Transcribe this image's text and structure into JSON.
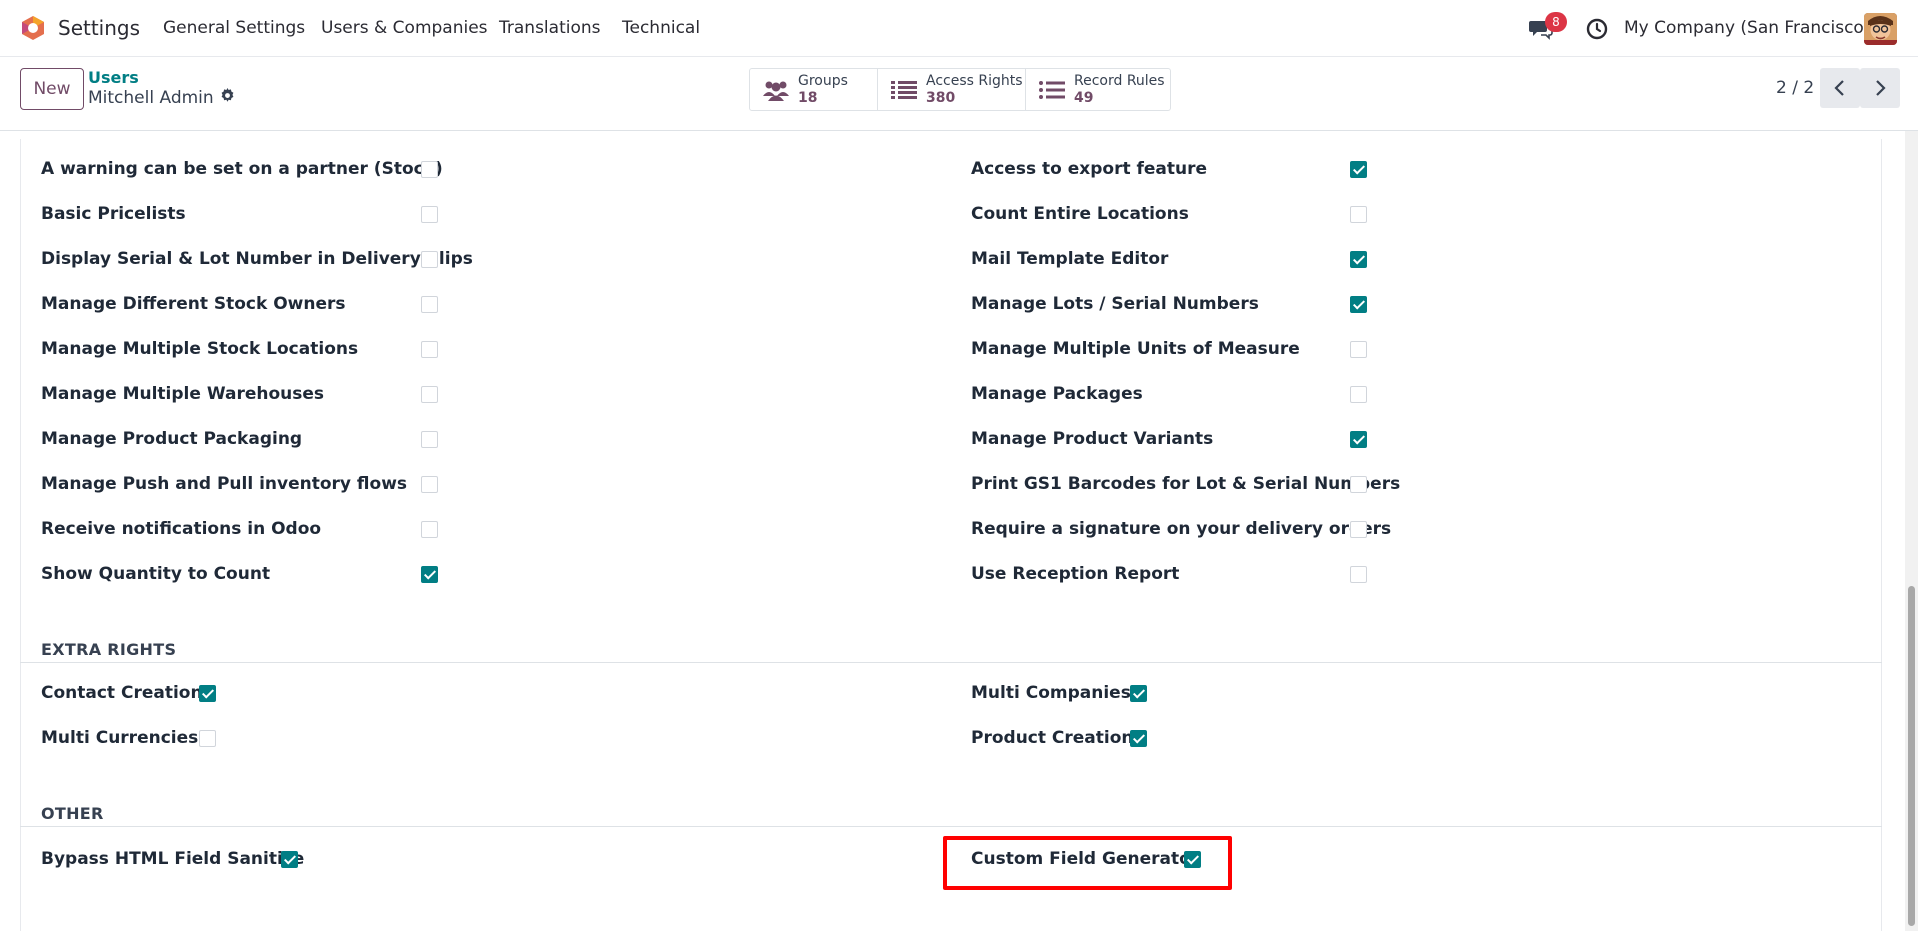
{
  "navbar": {
    "app_name": "Settings",
    "menu": [
      "General Settings",
      "Users & Companies",
      "Translations",
      "Technical"
    ],
    "messages_count": "8",
    "company": "My Company (San Francisco)"
  },
  "control_panel": {
    "new_label": "New",
    "breadcrumb_parent": "Users",
    "record_name": "Mitchell Admin",
    "smart_buttons": [
      {
        "label": "Groups",
        "value": "18",
        "icon": "users-icon"
      },
      {
        "label": "Access Rights",
        "value": "380",
        "icon": "list-icon"
      },
      {
        "label": "Record Rules",
        "value": "49",
        "icon": "list-icon"
      }
    ],
    "pager": "2 / 2"
  },
  "technical_rights": {
    "left": [
      {
        "label": "A warning can be set on a partner (Stock)",
        "checked": false
      },
      {
        "label": "Basic Pricelists",
        "checked": false
      },
      {
        "label": "Display Serial & Lot Number in Delivery Slips",
        "checked": false
      },
      {
        "label": "Manage Different Stock Owners",
        "checked": false
      },
      {
        "label": "Manage Multiple Stock Locations",
        "checked": false
      },
      {
        "label": "Manage Multiple Warehouses",
        "checked": false
      },
      {
        "label": "Manage Product Packaging",
        "checked": false
      },
      {
        "label": "Manage Push and Pull inventory flows",
        "checked": false
      },
      {
        "label": "Receive notifications in Odoo",
        "checked": false
      },
      {
        "label": "Show Quantity to Count",
        "checked": true
      }
    ],
    "right": [
      {
        "label": "Access to export feature",
        "checked": true
      },
      {
        "label": "Count Entire Locations",
        "checked": false
      },
      {
        "label": "Mail Template Editor",
        "checked": true
      },
      {
        "label": "Manage Lots / Serial Numbers",
        "checked": true
      },
      {
        "label": "Manage Multiple Units of Measure",
        "checked": false
      },
      {
        "label": "Manage Packages",
        "checked": false
      },
      {
        "label": "Manage Product Variants",
        "checked": true
      },
      {
        "label": "Print GS1 Barcodes for Lot & Serial Numbers",
        "checked": false
      },
      {
        "label": "Require a signature on your delivery orders",
        "checked": false
      },
      {
        "label": "Use Reception Report",
        "checked": false
      }
    ]
  },
  "extra_rights": {
    "title": "EXTRA RIGHTS",
    "items": [
      {
        "label": "Contact Creation",
        "checked": true
      },
      {
        "label": "Multi Companies",
        "checked": true
      },
      {
        "label": "Multi Currencies",
        "checked": false
      },
      {
        "label": "Product Creation",
        "checked": true
      }
    ]
  },
  "other": {
    "title": "OTHER",
    "items": [
      {
        "label": "Bypass HTML Field Sanitize",
        "checked": true
      },
      {
        "label": "Custom Field Generator",
        "checked": true
      }
    ]
  },
  "colors": {
    "accent": "#017e84",
    "brand": "#714b67",
    "highlight": "#ff0000"
  }
}
